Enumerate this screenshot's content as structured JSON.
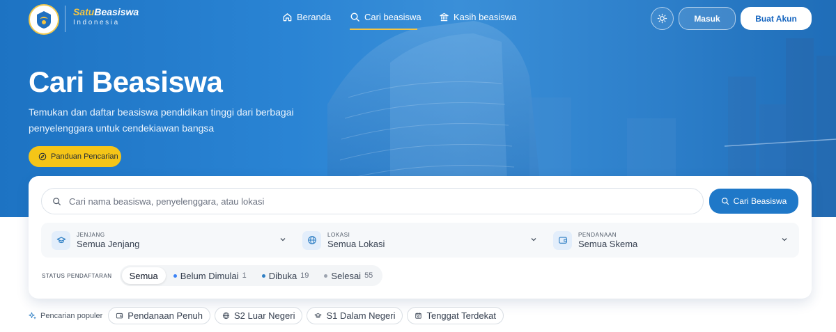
{
  "brand": {
    "title_part1": "Satu",
    "title_part2": "Beasiswa",
    "subtitle": "Indonesia"
  },
  "nav": {
    "items": [
      {
        "label": "Beranda",
        "icon": "home-icon"
      },
      {
        "label": "Cari beasiswa",
        "icon": "search-icon",
        "active": true
      },
      {
        "label": "Kasih beasiswa",
        "icon": "institution-icon"
      }
    ],
    "login_label": "Masuk",
    "register_label": "Buat Akun"
  },
  "hero": {
    "title": "Cari Beasiswa",
    "description": "Temukan dan daftar beasiswa pendidikan tinggi dari berbagai penyelenggara untuk cendekiawan bangsa",
    "guide_label": "Panduan Pencarian"
  },
  "search": {
    "placeholder": "Cari nama beasiswa, penyelenggara, atau lokasi",
    "value": "",
    "button_label": "Cari Beasiswa"
  },
  "filters": [
    {
      "label": "JENJANG",
      "value": "Semua Jenjang",
      "icon": "graduation-cap-icon"
    },
    {
      "label": "LOKASI",
      "value": "Semua Lokasi",
      "icon": "globe-icon"
    },
    {
      "label": "PENDANAAN",
      "value": "Semua Skema",
      "icon": "wallet-icon"
    }
  ],
  "status": {
    "label": "STATUS PENDAFTARAN",
    "options": [
      {
        "label": "Semua",
        "count": "",
        "active": true
      },
      {
        "label": "Belum Dimulai",
        "count": "1",
        "color": "#3b82f6"
      },
      {
        "label": "Dibuka",
        "count": "19",
        "color": "#2f7fc4"
      },
      {
        "label": "Selesai",
        "count": "55",
        "color": "#9ca3af"
      }
    ]
  },
  "popular": {
    "label": "Pencarian populer",
    "chips": [
      {
        "label": "Pendanaan Penuh",
        "icon": "wallet-icon"
      },
      {
        "label": "S2 Luar Negeri",
        "icon": "globe-icon"
      },
      {
        "label": "S1 Dalam Negeri",
        "icon": "graduation-cap-icon"
      },
      {
        "label": "Tenggat Terdekat",
        "icon": "calendar-icon"
      }
    ]
  },
  "colors": {
    "primary": "#1f78c8",
    "accent": "#f5c518",
    "hero_bg": "#2a84d4"
  }
}
